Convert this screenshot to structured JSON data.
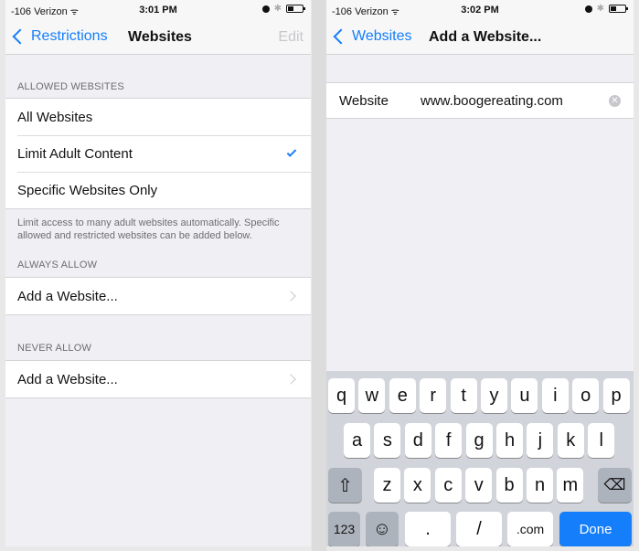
{
  "left": {
    "status": {
      "carrier": "-106 Verizon",
      "time": "3:01 PM"
    },
    "nav": {
      "back_label": "Restrictions",
      "title": "Websites",
      "edit_label": "Edit"
    },
    "allowed_section": {
      "header": "ALLOWED WEBSITES",
      "options": [
        {
          "label": "All Websites",
          "selected": false
        },
        {
          "label": "Limit Adult Content",
          "selected": true
        },
        {
          "label": "Specific Websites Only",
          "selected": false
        }
      ],
      "footer": "Limit access to many adult websites automatically. Specific allowed and restricted websites can be added below."
    },
    "always_allow": {
      "header": "ALWAYS ALLOW",
      "item": "Add a Website..."
    },
    "never_allow": {
      "header": "NEVER ALLOW",
      "item": "Add a Website..."
    }
  },
  "right": {
    "status": {
      "carrier": "-106 Verizon",
      "time": "3:02 PM"
    },
    "nav": {
      "back_label": "Websites",
      "title": "Add a Website..."
    },
    "field": {
      "label": "Website",
      "value": "www.boogereating.com"
    },
    "keyboard": {
      "row1": [
        "q",
        "w",
        "e",
        "r",
        "t",
        "y",
        "u",
        "i",
        "o",
        "p"
      ],
      "row2": [
        "a",
        "s",
        "d",
        "f",
        "g",
        "h",
        "j",
        "k",
        "l"
      ],
      "row3": [
        "z",
        "x",
        "c",
        "v",
        "b",
        "n",
        "m"
      ],
      "shift": "⇧",
      "delete": "⌫",
      "numbers": "123",
      "emoji": "☺",
      "dot": ".",
      "slash": "/",
      "dotcom": ".com",
      "done": "Done"
    }
  },
  "colors": {
    "accent": "#157efb",
    "background": "#efeff4"
  }
}
